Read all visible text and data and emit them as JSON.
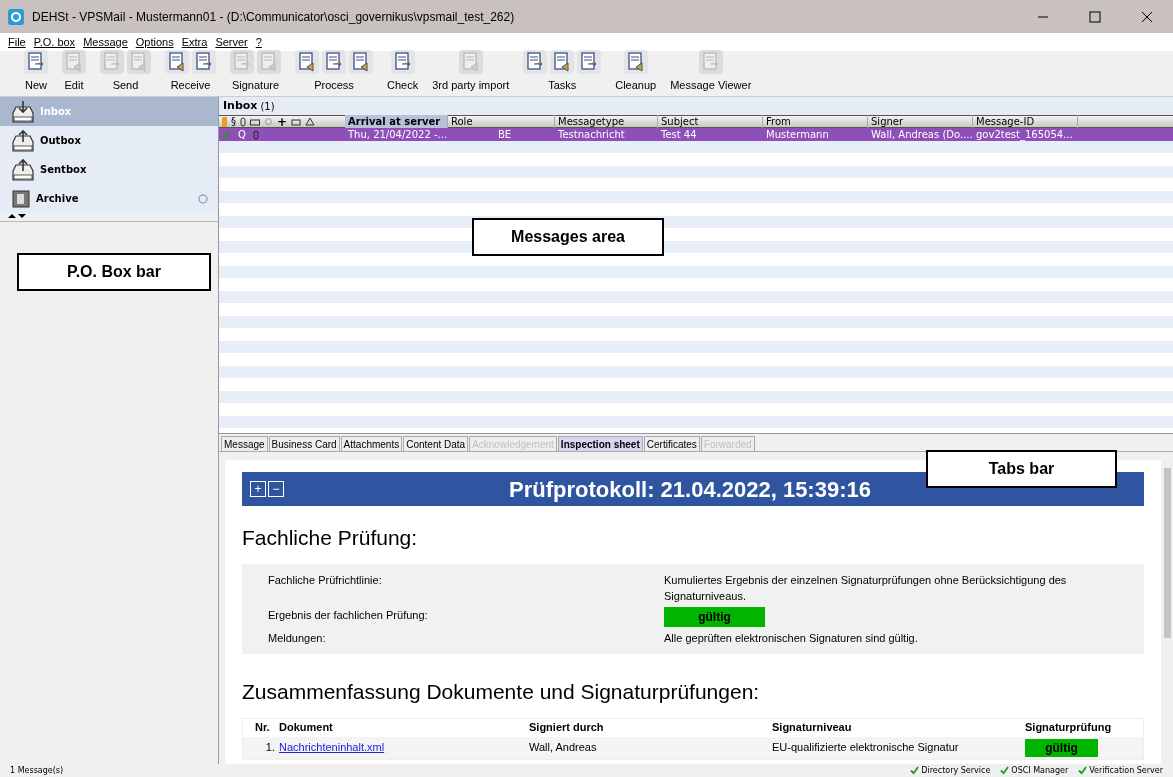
{
  "window": {
    "title": "DEHSt - VPSMail - Mustermann01 - (D:\\Communicator\\osci_governikus\\vpsmail_test_262)"
  },
  "menu": [
    {
      "label": "File"
    },
    {
      "label": "P.O. box"
    },
    {
      "label": "Message"
    },
    {
      "label": "Options"
    },
    {
      "label": "Extra"
    },
    {
      "label": "Server"
    },
    {
      "label": "?"
    }
  ],
  "toolbar": [
    {
      "label": "New",
      "icons": [
        {
          "disabled": false
        }
      ]
    },
    {
      "label": "Edit",
      "icons": [
        {
          "disabled": true
        }
      ]
    },
    {
      "label": "Send",
      "icons": [
        {
          "disabled": true
        },
        {
          "disabled": true
        }
      ]
    },
    {
      "label": "Receive",
      "icons": [
        {
          "disabled": false
        },
        {
          "disabled": false
        }
      ]
    },
    {
      "label": "Signature",
      "icons": [
        {
          "disabled": true
        },
        {
          "disabled": true
        }
      ]
    },
    {
      "label": "Process",
      "icons": [
        {
          "disabled": false
        },
        {
          "disabled": false
        },
        {
          "disabled": false
        }
      ]
    },
    {
      "label": "Check",
      "icons": [
        {
          "disabled": false
        }
      ]
    },
    {
      "label": "3rd party import",
      "icons": [
        {
          "disabled": true
        }
      ]
    },
    {
      "label": "Tasks",
      "icons": [
        {
          "disabled": false
        },
        {
          "disabled": false
        },
        {
          "disabled": false
        }
      ]
    },
    {
      "label": "Cleanup",
      "icons": [
        {
          "disabled": false
        }
      ]
    },
    {
      "label": "Message Viewer",
      "icons": [
        {
          "disabled": true
        }
      ]
    }
  ],
  "sidebar": {
    "items": [
      {
        "label": "Inbox",
        "selected": true
      },
      {
        "label": "Outbox",
        "selected": false
      },
      {
        "label": "Sentbox",
        "selected": false
      },
      {
        "label": "Archive",
        "selected": false
      }
    ]
  },
  "inbox": {
    "title": "Inbox",
    "count": "(1)"
  },
  "table": {
    "icon_columns": [
      "§",
      "+"
    ],
    "columns": [
      "Arrival at server",
      "Role",
      "Messagetype",
      "Subject",
      "From",
      "Signer",
      "Message-ID"
    ],
    "rows": [
      {
        "selected": true,
        "flag": "Q",
        "cells": [
          "Thu, 21/04/2022 -...",
          "BE",
          "Testnachricht",
          "Test 44",
          "Mustermann",
          "Wall, Andreas (Do....",
          "gov2test_165054..."
        ]
      }
    ]
  },
  "tabs": [
    {
      "label": "Message",
      "selected": false,
      "disabled": false
    },
    {
      "label": "Business Card",
      "selected": false,
      "disabled": false
    },
    {
      "label": "Attachments",
      "selected": false,
      "disabled": false
    },
    {
      "label": "Content Data",
      "selected": false,
      "disabled": false
    },
    {
      "label": "Acknowledgement",
      "selected": false,
      "disabled": true
    },
    {
      "label": "Inspection sheet",
      "selected": true,
      "disabled": false
    },
    {
      "label": "Certificates",
      "selected": false,
      "disabled": false
    },
    {
      "label": "Forwarded",
      "selected": false,
      "disabled": true
    }
  ],
  "report": {
    "expand": "+",
    "collapse": "−",
    "title": "Prüfprotokoll: 21.04.2022, 15:39:16",
    "section_title": "Fachliche Prüfung:",
    "fields": [
      {
        "label": "Fachliche Prüfrichtlinie:",
        "value": "Kumuliertes Ergebnis der einzelnen Signaturprüfungen ohne Berücksichtigung des Signaturniveaus.",
        "kind": "text"
      },
      {
        "label": "Ergebnis der fachlichen Prüfung:",
        "value": "gültig",
        "kind": "badge"
      },
      {
        "label": "Meldungen:",
        "value": "Alle geprüften elektronischen Signaturen sind gültig.",
        "kind": "text"
      }
    ],
    "summary_title": "Zusammenfassung Dokumente und Signaturprüfungen:",
    "summary_columns": [
      "Nr.",
      "Dokument",
      "Signiert durch",
      "Signaturniveau",
      "Signaturprüfung"
    ],
    "summary_rows": [
      {
        "nr": "1.",
        "document": "Nachrichteninhalt.xml",
        "signed_by": "Wall, Andreas",
        "level": "EU-qualifizierte elektronische Signatur",
        "result": "gültig"
      }
    ]
  },
  "annotations": [
    "Messages area",
    "P.O. Box bar",
    "Tabs bar"
  ],
  "status_bar": {
    "text": "1 Message(s)",
    "services": [
      {
        "label": "Directory Service",
        "ok": true
      },
      {
        "label": "OSCI Manager",
        "ok": true
      },
      {
        "label": "Verification Server",
        "ok": true
      }
    ]
  }
}
